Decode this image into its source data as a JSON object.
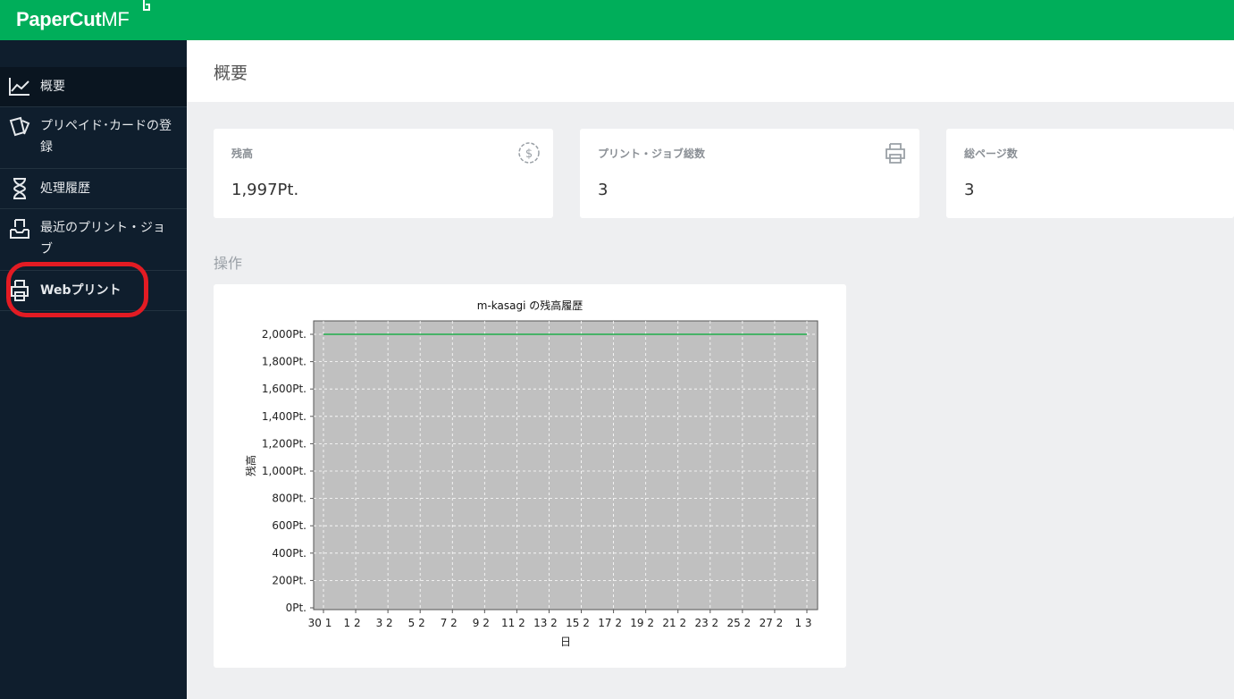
{
  "app": {
    "logo_main": "PaperCut",
    "logo_suffix": "MF"
  },
  "sidebar": {
    "items": [
      {
        "label": "概要",
        "icon": "line-chart-icon",
        "active": true
      },
      {
        "label": "プリペイド･カードの登録",
        "icon": "card-icon",
        "active": false
      },
      {
        "label": "処理履歴",
        "icon": "hourglass-icon",
        "active": false
      },
      {
        "label": "最近のプリント・ジョブ",
        "icon": "inbox-tray-icon",
        "active": false
      },
      {
        "label": "Webプリント",
        "icon": "web-print-icon",
        "active": false
      }
    ]
  },
  "header": {
    "title": "概要"
  },
  "cards": [
    {
      "label": "残高",
      "value": "1,997Pt.",
      "icon": "dollar-circle-icon"
    },
    {
      "label": "プリント・ジョブ総数",
      "value": "3",
      "icon": "printer-icon"
    },
    {
      "label": "総ページ数",
      "value": "3",
      "icon": ""
    }
  ],
  "section": {
    "title": "操作"
  },
  "colors": {
    "brand": "#00ae5a",
    "sidebar": "#0f1e2d",
    "highlight": "#e31b23",
    "line": "#00aa33",
    "plot_bg": "#c0c0c0"
  },
  "chart_data": {
    "type": "line",
    "title": "m-kasagi の残高履歴",
    "xlabel": "日",
    "ylabel": "残高",
    "ylim": [
      0,
      2000
    ],
    "y_ticks": [
      "0Pt.",
      "200Pt.",
      "400Pt.",
      "600Pt.",
      "800Pt.",
      "1,000Pt.",
      "1,200Pt.",
      "1,400Pt.",
      "1,600Pt.",
      "1,800Pt.",
      "2,000Pt."
    ],
    "x_ticks": [
      "30 1",
      "1 2",
      "3 2",
      "5 2",
      "7 2",
      "9 2",
      "11 2",
      "13 2",
      "15 2",
      "17 2",
      "19 2",
      "21 2",
      "23 2",
      "25 2",
      "27 2",
      "1 3"
    ],
    "grid": true,
    "series": [
      {
        "values": [
          2000,
          2000,
          2000,
          2000,
          2000,
          2000,
          2000,
          2000,
          2000,
          2000,
          2000,
          2000,
          2000,
          2000,
          2000,
          2000
        ]
      }
    ]
  }
}
